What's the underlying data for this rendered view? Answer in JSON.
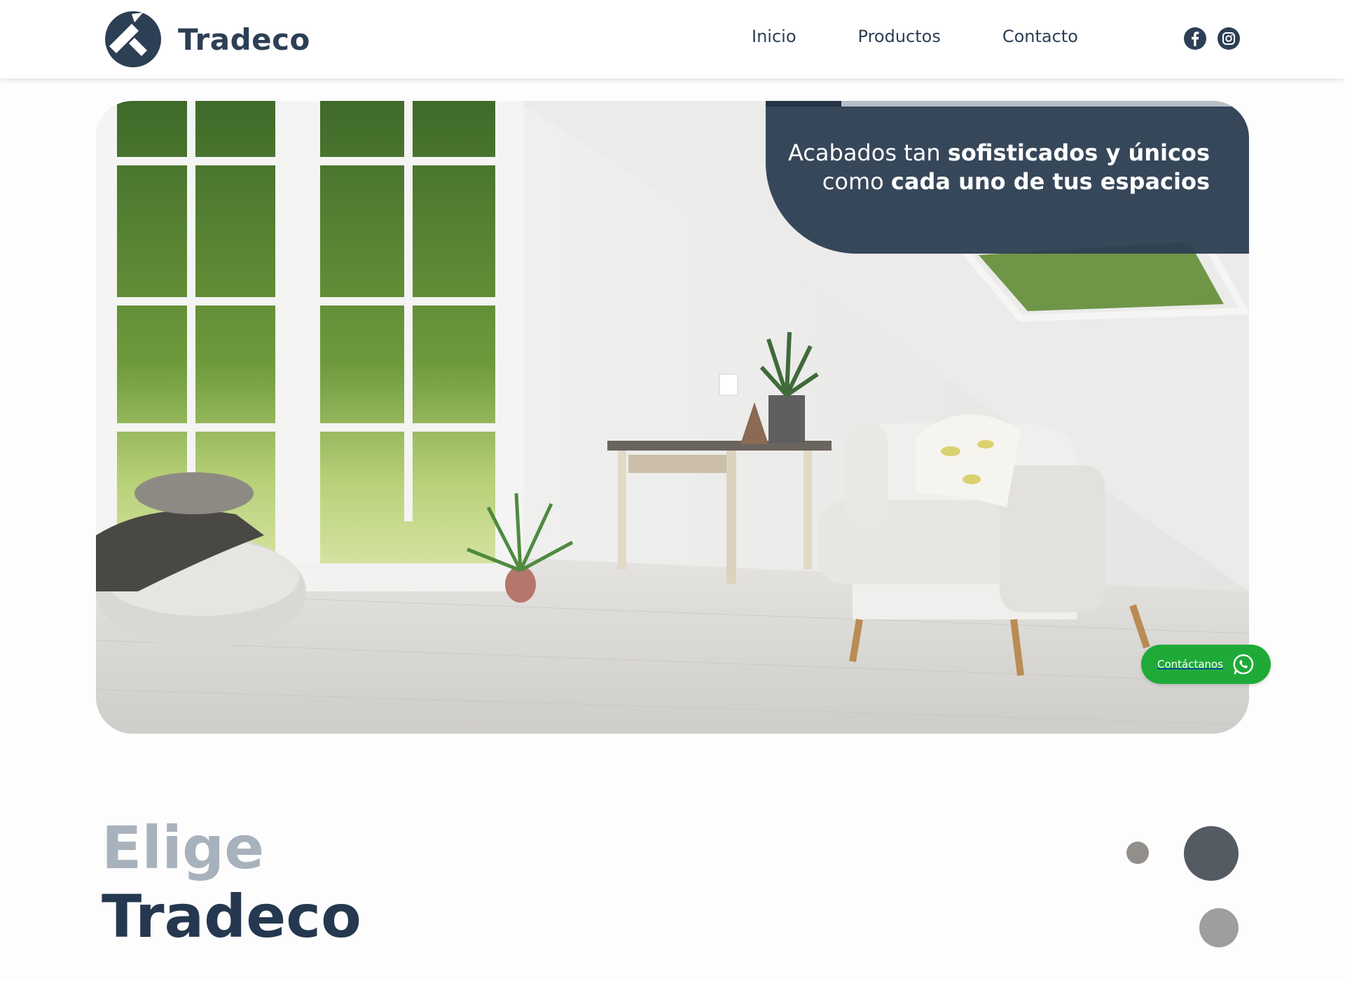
{
  "brand": {
    "name": "Tradeco",
    "logo_icon": "tradeco-logo-mark"
  },
  "nav": {
    "items": [
      "Inicio",
      "Productos",
      "Contacto"
    ]
  },
  "social": {
    "icons": [
      "facebook-icon",
      "instagram-icon"
    ]
  },
  "hero": {
    "line1_plain": "Acabados tan ",
    "line1_bold": "sofisticados y únicos",
    "line2_plain": "como ",
    "line2_bold": "cada uno de tus espacios"
  },
  "cta": {
    "label": "Contáctanos",
    "icon": "whatsapp-icon",
    "color": "#1faa38"
  },
  "section": {
    "line1": "Elige",
    "line2": "Tradeco"
  },
  "colors": {
    "primary": "#2d3f55",
    "muted": "#a8b2bd",
    "whatsapp": "#1faa38"
  }
}
